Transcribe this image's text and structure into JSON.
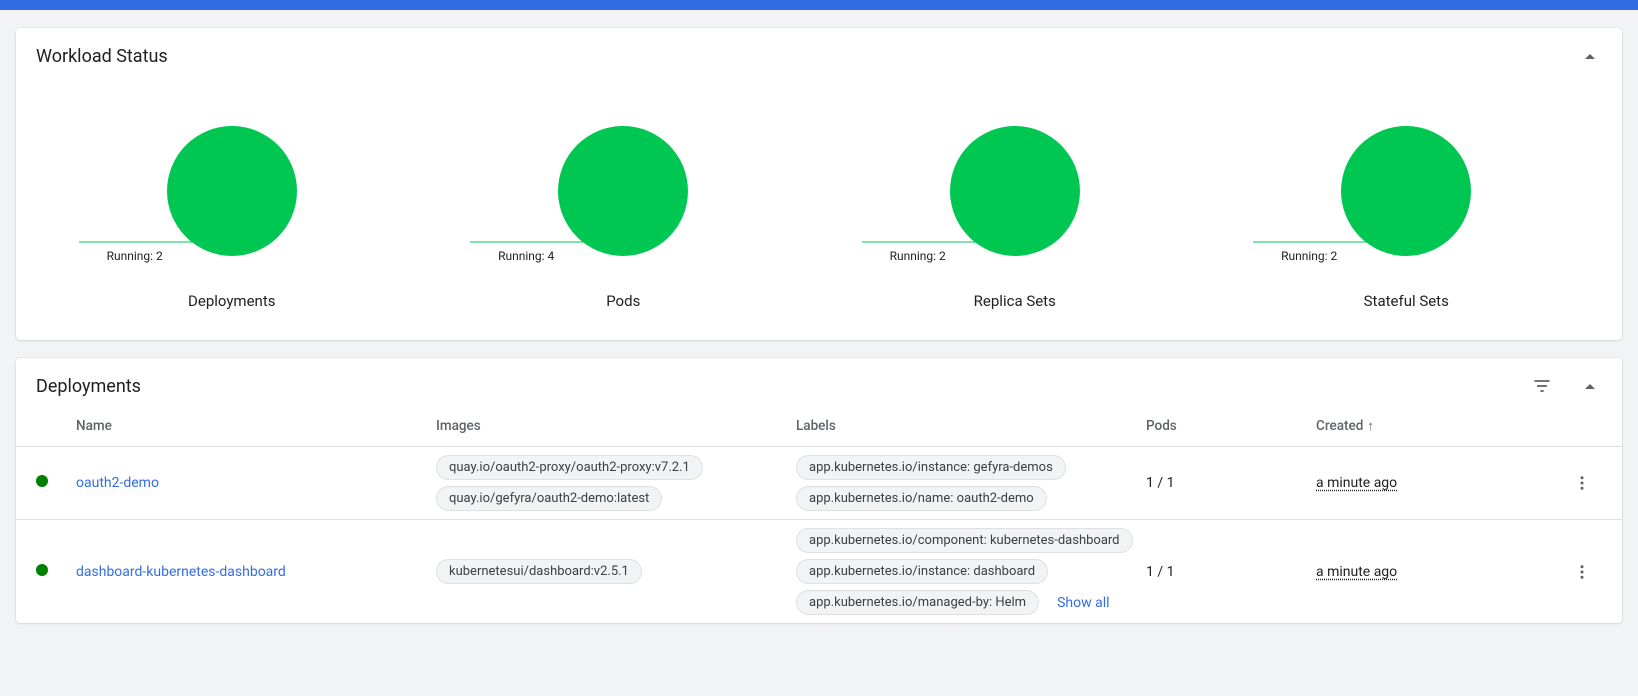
{
  "workload_status": {
    "title": "Workload Status",
    "items": [
      {
        "label": "Running: 2",
        "name": "Deployments"
      },
      {
        "label": "Running: 4",
        "name": "Pods"
      },
      {
        "label": "Running: 2",
        "name": "Replica Sets"
      },
      {
        "label": "Running: 2",
        "name": "Stateful Sets"
      }
    ]
  },
  "deployments": {
    "title": "Deployments",
    "columns": {
      "name": "Name",
      "images": "Images",
      "labels": "Labels",
      "pods": "Pods",
      "created": "Created"
    },
    "sort_indicator": "↑",
    "show_all": "Show all",
    "rows": [
      {
        "name": "oauth2-demo",
        "images": [
          "quay.io/oauth2-proxy/oauth2-proxy:v7.2.1",
          "quay.io/gefyra/oauth2-demo:latest"
        ],
        "labels": [
          "app.kubernetes.io/instance: gefyra-demos",
          "app.kubernetes.io/name: oauth2-demo"
        ],
        "labels_truncated": false,
        "pods": "1 / 1",
        "created": "a minute ago"
      },
      {
        "name": "dashboard-kubernetes-dashboard",
        "images": [
          "kubernetesui/dashboard:v2.5.1"
        ],
        "labels": [
          "app.kubernetes.io/component: kubernetes-dashboard",
          "app.kubernetes.io/instance: dashboard",
          "app.kubernetes.io/managed-by: Helm"
        ],
        "labels_truncated": true,
        "pods": "1 / 1",
        "created": "a minute ago"
      }
    ]
  },
  "chart_data": [
    {
      "type": "pie",
      "title": "Deployments",
      "series": [
        {
          "name": "Running",
          "value": 2
        }
      ],
      "total": 2,
      "color": "#00c752"
    },
    {
      "type": "pie",
      "title": "Pods",
      "series": [
        {
          "name": "Running",
          "value": 4
        }
      ],
      "total": 4,
      "color": "#00c752"
    },
    {
      "type": "pie",
      "title": "Replica Sets",
      "series": [
        {
          "name": "Running",
          "value": 2
        }
      ],
      "total": 2,
      "color": "#00c752"
    },
    {
      "type": "pie",
      "title": "Stateful Sets",
      "series": [
        {
          "name": "Running",
          "value": 2
        }
      ],
      "total": 2,
      "color": "#00c752"
    }
  ]
}
